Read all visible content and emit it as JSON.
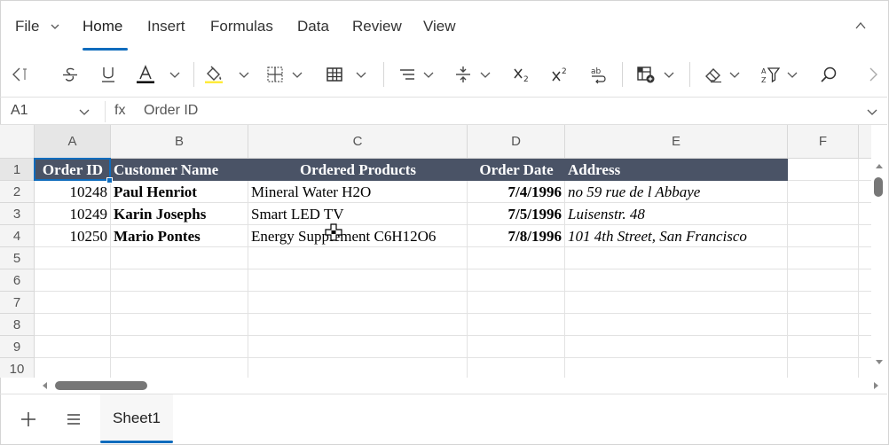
{
  "ribbon": {
    "tabs": [
      "File",
      "Home",
      "Insert",
      "Formulas",
      "Data",
      "Review",
      "View"
    ],
    "active_tab": "Home"
  },
  "toolbar": {
    "icons": [
      "scroll-left-icon",
      "strikethrough-icon",
      "underline-icon",
      "font-color-icon",
      "fill-color-icon",
      "borders-icon",
      "merge-cells-icon",
      "horizontal-align-icon",
      "vertical-align-icon",
      "subscript-icon",
      "superscript-icon",
      "wrap-text-icon",
      "conditional-format-icon",
      "clear-icon",
      "sort-filter-icon",
      "find-icon",
      "scroll-right-icon"
    ],
    "font_color": "#000000",
    "fill_color": "#ffeb3b"
  },
  "formula_bar": {
    "name_box": "A1",
    "fx_label": "fx",
    "value": "Order ID"
  },
  "columns": [
    "A",
    "B",
    "C",
    "D",
    "E",
    "F"
  ],
  "rows": [
    "1",
    "2",
    "3",
    "4",
    "5",
    "6",
    "7",
    "8",
    "9",
    "10"
  ],
  "table": {
    "header_color": "#4a5366",
    "headers": [
      "Order ID",
      "Customer Name",
      "Ordered Products",
      "Order Date",
      "Address"
    ],
    "records": [
      [
        "10248",
        "Paul Henriot",
        "Mineral Water H2O",
        "7/4/1996",
        "no 59 rue de l Abbaye"
      ],
      [
        "10249",
        "Karin Josephs",
        "Smart LED TV",
        "7/5/1996",
        "Luisenstr. 48"
      ],
      [
        "10250",
        "Mario Pontes",
        "Energy Supplement C6H12O6",
        "7/8/1996",
        "101 4th Street, San Francisco"
      ]
    ]
  },
  "sheets": {
    "active": "Sheet1"
  },
  "accent_color": "#0f6cbd"
}
